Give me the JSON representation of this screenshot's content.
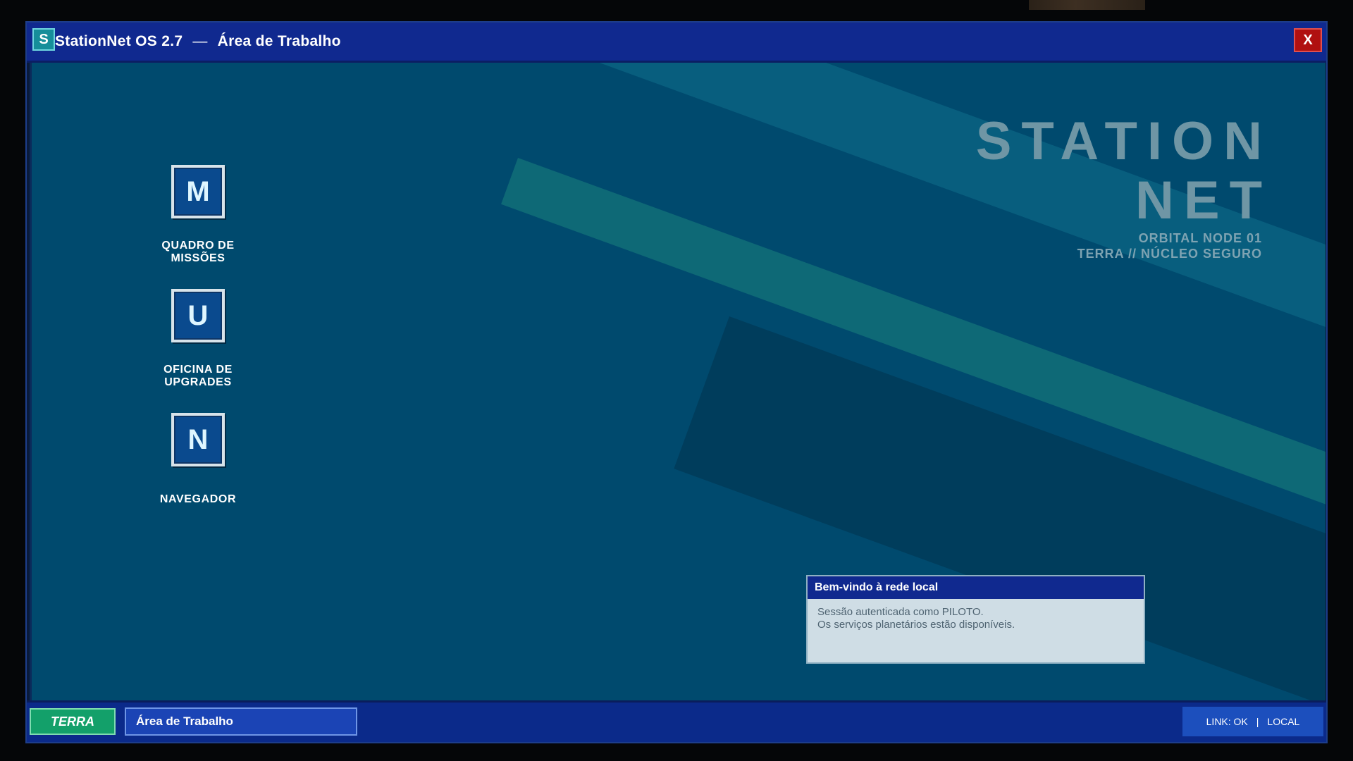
{
  "window": {
    "logo_letter": "S",
    "title": "StationNet OS 2.7",
    "title_separator": "—",
    "subtitle": "Área de Trabalho",
    "close_label": "X"
  },
  "brand": {
    "line1": "STATION",
    "line2": "NET",
    "sub1": "ORBITAL NODE 01",
    "sub2": "TERRA // NÚCLEO SEGURO"
  },
  "desktop_icons": [
    {
      "letter": "M",
      "label": "QUADRO DE\nMISSÕES",
      "icon": "missions-icon"
    },
    {
      "letter": "U",
      "label": "OFICINA DE\nUPGRADES",
      "icon": "upgrades-icon"
    },
    {
      "letter": "N",
      "label": "NAVEGADOR",
      "icon": "browser-icon"
    }
  ],
  "notification": {
    "title": "Bem-vindo à rede local",
    "line1": "Sessão autenticada como PILOTO.",
    "line2": "Os serviços planetários estão disponíveis."
  },
  "taskbar": {
    "start_label": "TERRA",
    "active_task": "Área de Trabalho",
    "tray_link": "LINK: OK",
    "tray_sep": "|",
    "tray_mode": "LOCAL"
  },
  "colors": {
    "titlebar": "#10298f",
    "desktop": "#004a6e",
    "start_button": "#13a06a",
    "close_button": "#b01010"
  }
}
